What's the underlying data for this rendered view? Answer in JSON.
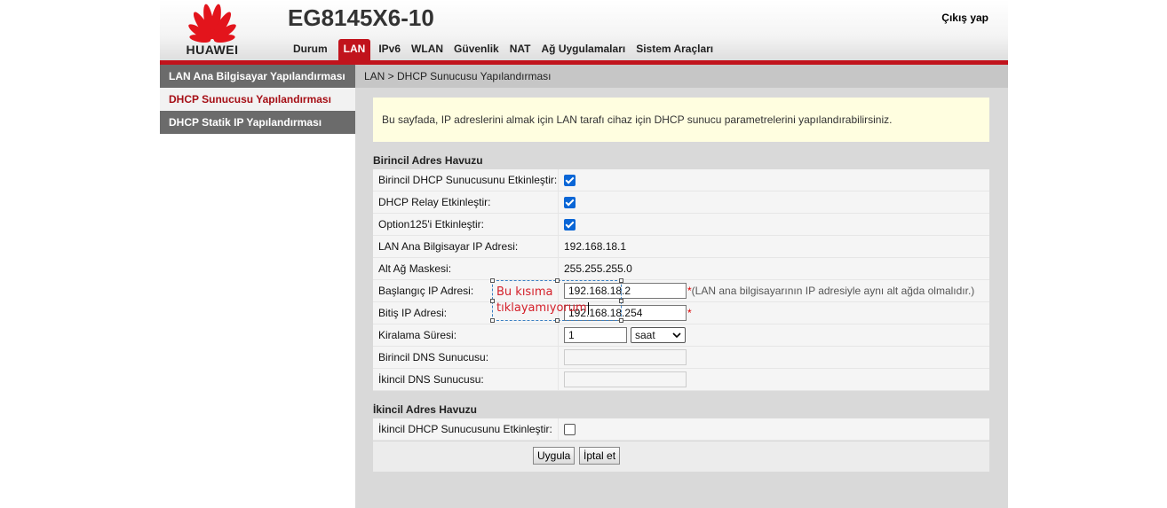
{
  "header": {
    "brand": "HUAWEI",
    "model": "EG8145X6-10",
    "logout": "Çıkış yap",
    "nav": [
      "Durum",
      "LAN",
      "IPv6",
      "WLAN",
      "Güvenlik",
      "NAT",
      "Ağ Uygulamaları",
      "Sistem Araçları"
    ],
    "active_nav": "LAN"
  },
  "sidebar": {
    "items": [
      {
        "label": "LAN Ana Bilgisayar Yapılandırması"
      },
      {
        "label": "DHCP Sunucusu Yapılandırması"
      },
      {
        "label": "DHCP Statik IP Yapılandırması"
      }
    ]
  },
  "content": {
    "breadcrumb": "LAN > DHCP Sunucusu Yapılandırması",
    "info": "Bu sayfada, IP adreslerini almak için LAN tarafı cihaz için DHCP sunucu parametrelerini yapılandırabilirsiniz.",
    "primary": {
      "title": "Birincil Adres Havuzu",
      "enable_label": "Birincil DHCP Sunucusunu Etkinleştir:",
      "enable_checked": true,
      "relay_label": "DHCP Relay Etkinleştir:",
      "relay_checked": true,
      "opt125_label": "Option125'i Etkinleştir:",
      "opt125_checked": true,
      "host_ip_label": "LAN Ana Bilgisayar IP Adresi:",
      "host_ip": "192.168.18.1",
      "mask_label": "Alt Ağ Maskesi:",
      "mask": "255.255.255.0",
      "start_label": "Başlangıç IP Adresi:",
      "start_ip": "192.168.18.2",
      "star": "*",
      "start_hint": "(LAN ana bilgisayarının IP adresiyle aynı alt ağda olmalıdır.)",
      "end_label": "Bitiş IP Adresi:",
      "end_ip": "192.168.18.254",
      "lease_label": "Kiralama Süresi:",
      "lease_value": "1",
      "lease_unit": "saat",
      "dns1_label": "Birincil DNS Sunucusu:",
      "dns2_label": "İkincil DNS Sunucusu:"
    },
    "secondary": {
      "title": "İkincil Adres Havuzu",
      "enable_label": "İkincil DHCP Sunucusunu Etkinleştir:",
      "enable_checked": false
    },
    "buttons": {
      "apply": "Uygula",
      "cancel": "İptal et"
    }
  },
  "annotation": {
    "line1": "Bu kısıma",
    "line2": "tıklayamıyorum",
    "color": "#d4202a"
  },
  "colors": {
    "accent": "#c1131c",
    "sidebar_dark": "#6b6b6b",
    "info_bg": "#fffee0"
  }
}
